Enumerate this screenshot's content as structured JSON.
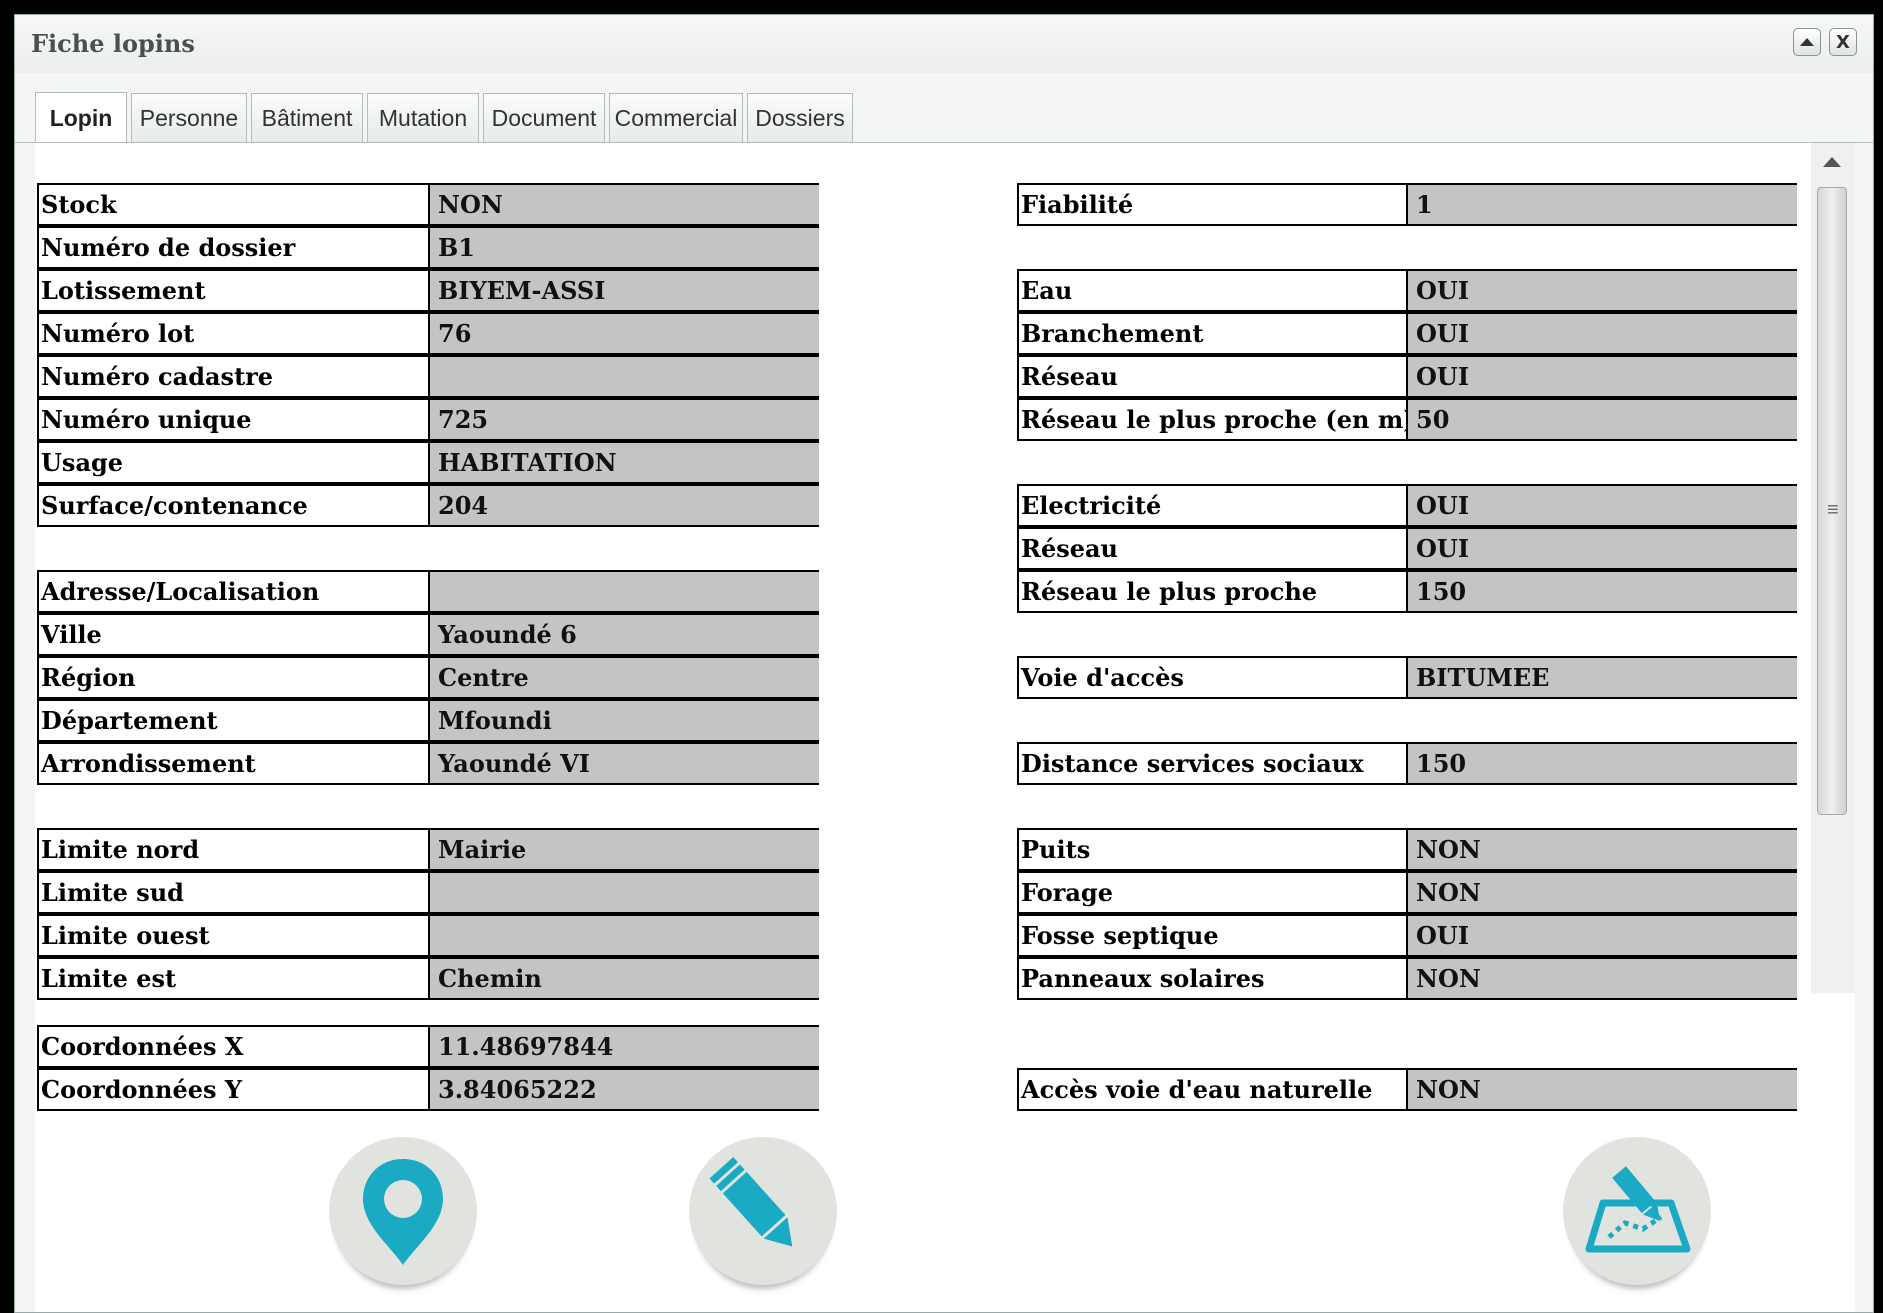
{
  "window": {
    "title": "Fiche lopins",
    "controls": {
      "collapse_icon": "triangle-up-icon",
      "close_icon": "close-x-icon",
      "close_label": "X"
    }
  },
  "tabs": [
    {
      "label": "Lopin",
      "active": true
    },
    {
      "label": "Personne",
      "active": false
    },
    {
      "label": "Bâtiment",
      "active": false
    },
    {
      "label": "Mutation",
      "active": false
    },
    {
      "label": "Document",
      "active": false
    },
    {
      "label": "Commercial",
      "active": false
    },
    {
      "label": "Dossiers",
      "active": false
    }
  ],
  "left_fields": [
    {
      "label": "Stock",
      "value": "NON"
    },
    {
      "label": "Numéro de dossier",
      "value": "B1"
    },
    {
      "label": "Lotissement",
      "value": "BIYEM-ASSI"
    },
    {
      "label": "Numéro lot",
      "value": "76"
    },
    {
      "label": "Numéro cadastre",
      "value": ""
    },
    {
      "label": "Numéro unique",
      "value": "725"
    },
    {
      "label": "Usage",
      "value": "HABITATION"
    },
    {
      "label": "Surface/contenance",
      "value": "204"
    },
    {
      "label": "Adresse/Localisation",
      "value": ""
    },
    {
      "label": "Ville",
      "value": "Yaoundé 6"
    },
    {
      "label": "Région",
      "value": "Centre"
    },
    {
      "label": "Département",
      "value": "Mfoundi"
    },
    {
      "label": "Arrondissement",
      "value": "Yaoundé VI"
    },
    {
      "label": "Limite nord",
      "value": "Mairie"
    },
    {
      "label": "Limite sud",
      "value": ""
    },
    {
      "label": "Limite ouest",
      "value": ""
    },
    {
      "label": "Limite est",
      "value": "Chemin"
    },
    {
      "label": "Coordonnées X",
      "value": "11.48697844"
    },
    {
      "label": "Coordonnées Y",
      "value": "3.84065222"
    }
  ],
  "right_fields": [
    {
      "label": "Fiabilité",
      "value": "1"
    },
    {
      "label": "Eau",
      "value": "OUI"
    },
    {
      "label": "Branchement",
      "value": "OUI"
    },
    {
      "label": "Réseau",
      "value": "OUI"
    },
    {
      "label": "Réseau le plus proche (en m)",
      "value": "50"
    },
    {
      "label": "Electricité",
      "value": "OUI"
    },
    {
      "label": "Réseau",
      "value": "OUI"
    },
    {
      "label": "Réseau le plus proche",
      "value": "150"
    },
    {
      "label": "Voie d'accès",
      "value": "BITUMEE"
    },
    {
      "label": "Distance services sociaux",
      "value": "150"
    },
    {
      "label": "Puits",
      "value": "NON"
    },
    {
      "label": "Forage",
      "value": "NON"
    },
    {
      "label": "Fosse septique",
      "value": "OUI"
    },
    {
      "label": "Panneaux solaires",
      "value": "NON"
    },
    {
      "label": "Accès voie d'eau naturelle",
      "value": "NON"
    }
  ],
  "actions": [
    {
      "icon": "map-pin-icon"
    },
    {
      "icon": "pencil-edit-icon"
    },
    {
      "icon": "map-draw-icon"
    }
  ],
  "colors": {
    "value_bg": "#c4c4c4",
    "icon_accent": "#1aaac4",
    "icon_circle": "#e1e3de"
  }
}
